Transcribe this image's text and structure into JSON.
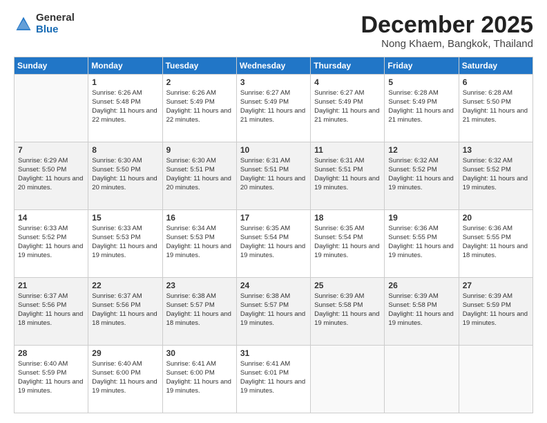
{
  "logo": {
    "general": "General",
    "blue": "Blue"
  },
  "header": {
    "month": "December 2025",
    "location": "Nong Khaem, Bangkok, Thailand"
  },
  "days": [
    "Sunday",
    "Monday",
    "Tuesday",
    "Wednesday",
    "Thursday",
    "Friday",
    "Saturday"
  ],
  "weeks": [
    [
      {
        "num": "",
        "empty": true
      },
      {
        "num": "1",
        "sunrise": "Sunrise: 6:26 AM",
        "sunset": "Sunset: 5:48 PM",
        "daylight": "Daylight: 11 hours and 22 minutes."
      },
      {
        "num": "2",
        "sunrise": "Sunrise: 6:26 AM",
        "sunset": "Sunset: 5:49 PM",
        "daylight": "Daylight: 11 hours and 22 minutes."
      },
      {
        "num": "3",
        "sunrise": "Sunrise: 6:27 AM",
        "sunset": "Sunset: 5:49 PM",
        "daylight": "Daylight: 11 hours and 21 minutes."
      },
      {
        "num": "4",
        "sunrise": "Sunrise: 6:27 AM",
        "sunset": "Sunset: 5:49 PM",
        "daylight": "Daylight: 11 hours and 21 minutes."
      },
      {
        "num": "5",
        "sunrise": "Sunrise: 6:28 AM",
        "sunset": "Sunset: 5:49 PM",
        "daylight": "Daylight: 11 hours and 21 minutes."
      },
      {
        "num": "6",
        "sunrise": "Sunrise: 6:28 AM",
        "sunset": "Sunset: 5:50 PM",
        "daylight": "Daylight: 11 hours and 21 minutes."
      }
    ],
    [
      {
        "num": "7",
        "sunrise": "Sunrise: 6:29 AM",
        "sunset": "Sunset: 5:50 PM",
        "daylight": "Daylight: 11 hours and 20 minutes."
      },
      {
        "num": "8",
        "sunrise": "Sunrise: 6:30 AM",
        "sunset": "Sunset: 5:50 PM",
        "daylight": "Daylight: 11 hours and 20 minutes."
      },
      {
        "num": "9",
        "sunrise": "Sunrise: 6:30 AM",
        "sunset": "Sunset: 5:51 PM",
        "daylight": "Daylight: 11 hours and 20 minutes."
      },
      {
        "num": "10",
        "sunrise": "Sunrise: 6:31 AM",
        "sunset": "Sunset: 5:51 PM",
        "daylight": "Daylight: 11 hours and 20 minutes."
      },
      {
        "num": "11",
        "sunrise": "Sunrise: 6:31 AM",
        "sunset": "Sunset: 5:51 PM",
        "daylight": "Daylight: 11 hours and 19 minutes."
      },
      {
        "num": "12",
        "sunrise": "Sunrise: 6:32 AM",
        "sunset": "Sunset: 5:52 PM",
        "daylight": "Daylight: 11 hours and 19 minutes."
      },
      {
        "num": "13",
        "sunrise": "Sunrise: 6:32 AM",
        "sunset": "Sunset: 5:52 PM",
        "daylight": "Daylight: 11 hours and 19 minutes."
      }
    ],
    [
      {
        "num": "14",
        "sunrise": "Sunrise: 6:33 AM",
        "sunset": "Sunset: 5:52 PM",
        "daylight": "Daylight: 11 hours and 19 minutes."
      },
      {
        "num": "15",
        "sunrise": "Sunrise: 6:33 AM",
        "sunset": "Sunset: 5:53 PM",
        "daylight": "Daylight: 11 hours and 19 minutes."
      },
      {
        "num": "16",
        "sunrise": "Sunrise: 6:34 AM",
        "sunset": "Sunset: 5:53 PM",
        "daylight": "Daylight: 11 hours and 19 minutes."
      },
      {
        "num": "17",
        "sunrise": "Sunrise: 6:35 AM",
        "sunset": "Sunset: 5:54 PM",
        "daylight": "Daylight: 11 hours and 19 minutes."
      },
      {
        "num": "18",
        "sunrise": "Sunrise: 6:35 AM",
        "sunset": "Sunset: 5:54 PM",
        "daylight": "Daylight: 11 hours and 19 minutes."
      },
      {
        "num": "19",
        "sunrise": "Sunrise: 6:36 AM",
        "sunset": "Sunset: 5:55 PM",
        "daylight": "Daylight: 11 hours and 19 minutes."
      },
      {
        "num": "20",
        "sunrise": "Sunrise: 6:36 AM",
        "sunset": "Sunset: 5:55 PM",
        "daylight": "Daylight: 11 hours and 18 minutes."
      }
    ],
    [
      {
        "num": "21",
        "sunrise": "Sunrise: 6:37 AM",
        "sunset": "Sunset: 5:56 PM",
        "daylight": "Daylight: 11 hours and 18 minutes."
      },
      {
        "num": "22",
        "sunrise": "Sunrise: 6:37 AM",
        "sunset": "Sunset: 5:56 PM",
        "daylight": "Daylight: 11 hours and 18 minutes."
      },
      {
        "num": "23",
        "sunrise": "Sunrise: 6:38 AM",
        "sunset": "Sunset: 5:57 PM",
        "daylight": "Daylight: 11 hours and 18 minutes."
      },
      {
        "num": "24",
        "sunrise": "Sunrise: 6:38 AM",
        "sunset": "Sunset: 5:57 PM",
        "daylight": "Daylight: 11 hours and 19 minutes."
      },
      {
        "num": "25",
        "sunrise": "Sunrise: 6:39 AM",
        "sunset": "Sunset: 5:58 PM",
        "daylight": "Daylight: 11 hours and 19 minutes."
      },
      {
        "num": "26",
        "sunrise": "Sunrise: 6:39 AM",
        "sunset": "Sunset: 5:58 PM",
        "daylight": "Daylight: 11 hours and 19 minutes."
      },
      {
        "num": "27",
        "sunrise": "Sunrise: 6:39 AM",
        "sunset": "Sunset: 5:59 PM",
        "daylight": "Daylight: 11 hours and 19 minutes."
      }
    ],
    [
      {
        "num": "28",
        "sunrise": "Sunrise: 6:40 AM",
        "sunset": "Sunset: 5:59 PM",
        "daylight": "Daylight: 11 hours and 19 minutes."
      },
      {
        "num": "29",
        "sunrise": "Sunrise: 6:40 AM",
        "sunset": "Sunset: 6:00 PM",
        "daylight": "Daylight: 11 hours and 19 minutes."
      },
      {
        "num": "30",
        "sunrise": "Sunrise: 6:41 AM",
        "sunset": "Sunset: 6:00 PM",
        "daylight": "Daylight: 11 hours and 19 minutes."
      },
      {
        "num": "31",
        "sunrise": "Sunrise: 6:41 AM",
        "sunset": "Sunset: 6:01 PM",
        "daylight": "Daylight: 11 hours and 19 minutes."
      },
      {
        "num": "",
        "empty": true
      },
      {
        "num": "",
        "empty": true
      },
      {
        "num": "",
        "empty": true
      }
    ]
  ]
}
